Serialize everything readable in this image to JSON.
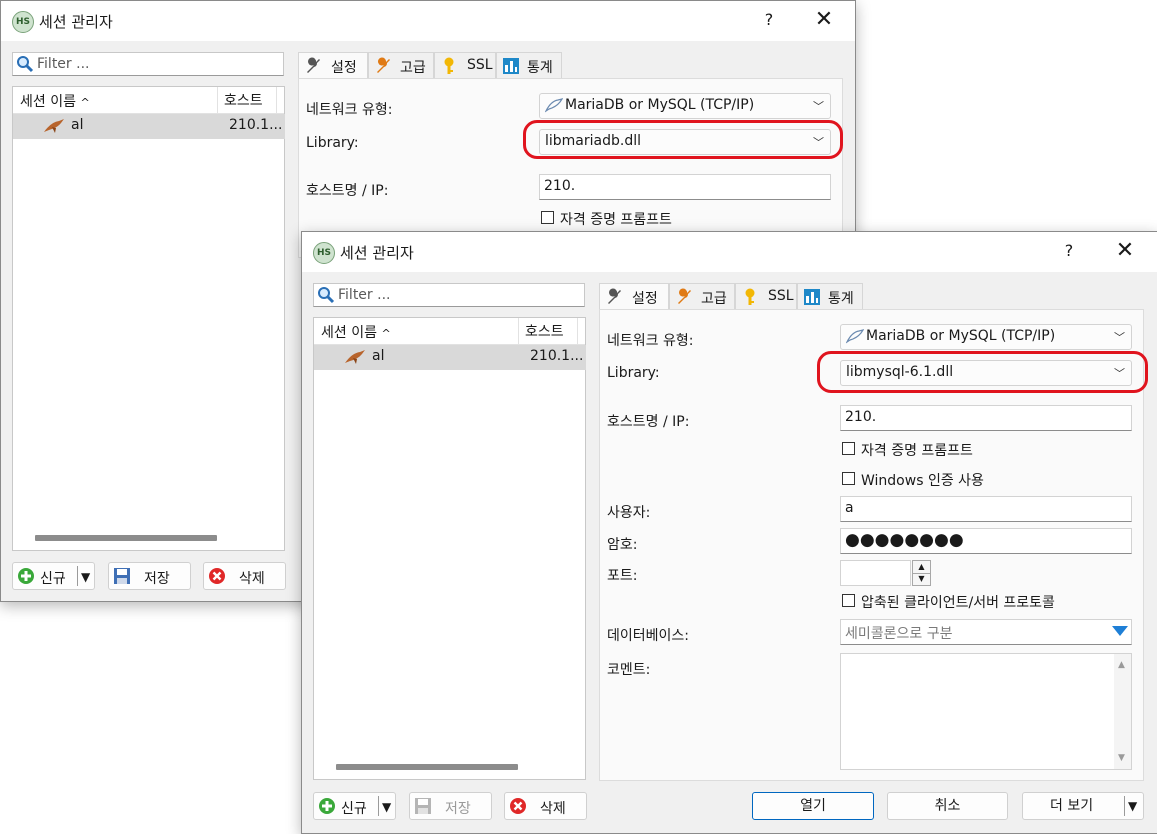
{
  "back_window": {
    "title": "세션 관리자",
    "help": "?",
    "close": "✕",
    "filter_placeholder": "Filter ...",
    "list": {
      "col_name": "세션 이름",
      "col_host": "호스트",
      "sort_arrow": "^",
      "row": {
        "name": "al",
        "host": "210.1..."
      }
    },
    "buttons": {
      "new": "신규",
      "save": "저장",
      "delete": "삭제"
    },
    "tabs": [
      "설정",
      "고급",
      "SSL",
      "통계"
    ],
    "fields": {
      "network_type_label": "네트워크 유형:",
      "network_type_value": "MariaDB or MySQL (TCP/IP)",
      "library_label": "Library:",
      "library_value": "libmariadb.dll",
      "host_label": "호스트명 / IP:",
      "host_value": "210.",
      "prompt_label": "자격 증명 프롬프트"
    }
  },
  "front_window": {
    "title": "세션 관리자",
    "help": "?",
    "close": "✕",
    "filter_placeholder": "Filter ...",
    "list": {
      "col_name": "세션 이름",
      "col_host": "호스트",
      "sort_arrow": "^",
      "row": {
        "name": "al",
        "host": "210.1..."
      }
    },
    "buttons": {
      "new": "신규",
      "save": "저장",
      "delete": "삭제"
    },
    "tabs": [
      "설정",
      "고급",
      "SSL",
      "통계"
    ],
    "fields": {
      "network_type_label": "네트워크 유형:",
      "network_type_value": "MariaDB or MySQL (TCP/IP)",
      "library_label": "Library:",
      "library_value": "libmysql-6.1.dll",
      "host_label": "호스트명 / IP:",
      "host_value": "210.",
      "prompt_label": "자격 증명 프롬프트",
      "windows_auth_label": "Windows 인증 사용",
      "user_label": "사용자:",
      "user_value": "a",
      "password_label": "암호:",
      "password_value": "●●●●●●●●",
      "port_label": "포트:",
      "port_value": "",
      "compress_label": "압축된 클라이언트/서버 프로토콜",
      "database_label": "데이터베이스:",
      "database_placeholder": "세미콜론으로 구분",
      "comment_label": "코멘트:"
    },
    "footer": {
      "open": "열기",
      "cancel": "취소",
      "more": "더 보기"
    }
  },
  "colors": {
    "highlight": "#e0141e",
    "accent": "#0067c0",
    "dropdown_arrow": "#1e7fd6"
  },
  "icons": [
    "hs-app-icon",
    "search-icon",
    "wrench-icon",
    "key-icon",
    "chart-icon",
    "dolphin-icon",
    "plus-icon",
    "floppy-icon",
    "delete-icon"
  ]
}
